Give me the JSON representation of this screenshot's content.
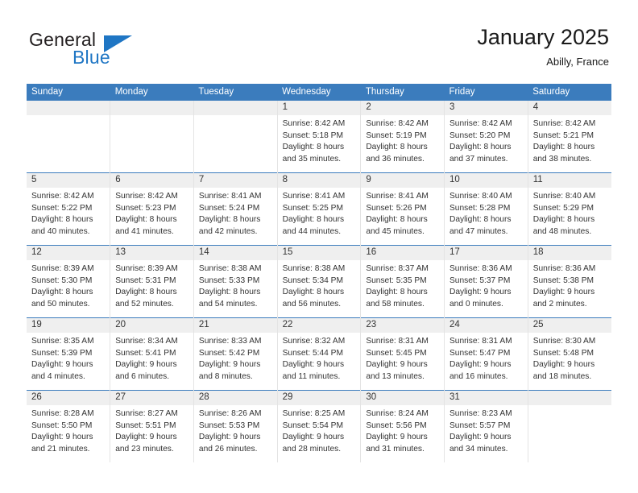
{
  "brand": {
    "name_part1": "General",
    "name_part2": "Blue",
    "triangle_color": "#1f76c4"
  },
  "header": {
    "title": "January 2025",
    "subtitle": "Abilly, France",
    "accent_color": "#3b7cbd",
    "daynum_band_color": "#efefef"
  },
  "weekday_headers": [
    "Sunday",
    "Monday",
    "Tuesday",
    "Wednesday",
    "Thursday",
    "Friday",
    "Saturday"
  ],
  "weeks": [
    [
      {
        "day": "",
        "sunrise": "",
        "sunset": "",
        "daylight_line1": "",
        "daylight_line2": ""
      },
      {
        "day": "",
        "sunrise": "",
        "sunset": "",
        "daylight_line1": "",
        "daylight_line2": ""
      },
      {
        "day": "",
        "sunrise": "",
        "sunset": "",
        "daylight_line1": "",
        "daylight_line2": ""
      },
      {
        "day": "1",
        "sunrise": "Sunrise: 8:42 AM",
        "sunset": "Sunset: 5:18 PM",
        "daylight_line1": "Daylight: 8 hours",
        "daylight_line2": "and 35 minutes."
      },
      {
        "day": "2",
        "sunrise": "Sunrise: 8:42 AM",
        "sunset": "Sunset: 5:19 PM",
        "daylight_line1": "Daylight: 8 hours",
        "daylight_line2": "and 36 minutes."
      },
      {
        "day": "3",
        "sunrise": "Sunrise: 8:42 AM",
        "sunset": "Sunset: 5:20 PM",
        "daylight_line1": "Daylight: 8 hours",
        "daylight_line2": "and 37 minutes."
      },
      {
        "day": "4",
        "sunrise": "Sunrise: 8:42 AM",
        "sunset": "Sunset: 5:21 PM",
        "daylight_line1": "Daylight: 8 hours",
        "daylight_line2": "and 38 minutes."
      }
    ],
    [
      {
        "day": "5",
        "sunrise": "Sunrise: 8:42 AM",
        "sunset": "Sunset: 5:22 PM",
        "daylight_line1": "Daylight: 8 hours",
        "daylight_line2": "and 40 minutes."
      },
      {
        "day": "6",
        "sunrise": "Sunrise: 8:42 AM",
        "sunset": "Sunset: 5:23 PM",
        "daylight_line1": "Daylight: 8 hours",
        "daylight_line2": "and 41 minutes."
      },
      {
        "day": "7",
        "sunrise": "Sunrise: 8:41 AM",
        "sunset": "Sunset: 5:24 PM",
        "daylight_line1": "Daylight: 8 hours",
        "daylight_line2": "and 42 minutes."
      },
      {
        "day": "8",
        "sunrise": "Sunrise: 8:41 AM",
        "sunset": "Sunset: 5:25 PM",
        "daylight_line1": "Daylight: 8 hours",
        "daylight_line2": "and 44 minutes."
      },
      {
        "day": "9",
        "sunrise": "Sunrise: 8:41 AM",
        "sunset": "Sunset: 5:26 PM",
        "daylight_line1": "Daylight: 8 hours",
        "daylight_line2": "and 45 minutes."
      },
      {
        "day": "10",
        "sunrise": "Sunrise: 8:40 AM",
        "sunset": "Sunset: 5:28 PM",
        "daylight_line1": "Daylight: 8 hours",
        "daylight_line2": "and 47 minutes."
      },
      {
        "day": "11",
        "sunrise": "Sunrise: 8:40 AM",
        "sunset": "Sunset: 5:29 PM",
        "daylight_line1": "Daylight: 8 hours",
        "daylight_line2": "and 48 minutes."
      }
    ],
    [
      {
        "day": "12",
        "sunrise": "Sunrise: 8:39 AM",
        "sunset": "Sunset: 5:30 PM",
        "daylight_line1": "Daylight: 8 hours",
        "daylight_line2": "and 50 minutes."
      },
      {
        "day": "13",
        "sunrise": "Sunrise: 8:39 AM",
        "sunset": "Sunset: 5:31 PM",
        "daylight_line1": "Daylight: 8 hours",
        "daylight_line2": "and 52 minutes."
      },
      {
        "day": "14",
        "sunrise": "Sunrise: 8:38 AM",
        "sunset": "Sunset: 5:33 PM",
        "daylight_line1": "Daylight: 8 hours",
        "daylight_line2": "and 54 minutes."
      },
      {
        "day": "15",
        "sunrise": "Sunrise: 8:38 AM",
        "sunset": "Sunset: 5:34 PM",
        "daylight_line1": "Daylight: 8 hours",
        "daylight_line2": "and 56 minutes."
      },
      {
        "day": "16",
        "sunrise": "Sunrise: 8:37 AM",
        "sunset": "Sunset: 5:35 PM",
        "daylight_line1": "Daylight: 8 hours",
        "daylight_line2": "and 58 minutes."
      },
      {
        "day": "17",
        "sunrise": "Sunrise: 8:36 AM",
        "sunset": "Sunset: 5:37 PM",
        "daylight_line1": "Daylight: 9 hours",
        "daylight_line2": "and 0 minutes."
      },
      {
        "day": "18",
        "sunrise": "Sunrise: 8:36 AM",
        "sunset": "Sunset: 5:38 PM",
        "daylight_line1": "Daylight: 9 hours",
        "daylight_line2": "and 2 minutes."
      }
    ],
    [
      {
        "day": "19",
        "sunrise": "Sunrise: 8:35 AM",
        "sunset": "Sunset: 5:39 PM",
        "daylight_line1": "Daylight: 9 hours",
        "daylight_line2": "and 4 minutes."
      },
      {
        "day": "20",
        "sunrise": "Sunrise: 8:34 AM",
        "sunset": "Sunset: 5:41 PM",
        "daylight_line1": "Daylight: 9 hours",
        "daylight_line2": "and 6 minutes."
      },
      {
        "day": "21",
        "sunrise": "Sunrise: 8:33 AM",
        "sunset": "Sunset: 5:42 PM",
        "daylight_line1": "Daylight: 9 hours",
        "daylight_line2": "and 8 minutes."
      },
      {
        "day": "22",
        "sunrise": "Sunrise: 8:32 AM",
        "sunset": "Sunset: 5:44 PM",
        "daylight_line1": "Daylight: 9 hours",
        "daylight_line2": "and 11 minutes."
      },
      {
        "day": "23",
        "sunrise": "Sunrise: 8:31 AM",
        "sunset": "Sunset: 5:45 PM",
        "daylight_line1": "Daylight: 9 hours",
        "daylight_line2": "and 13 minutes."
      },
      {
        "day": "24",
        "sunrise": "Sunrise: 8:31 AM",
        "sunset": "Sunset: 5:47 PM",
        "daylight_line1": "Daylight: 9 hours",
        "daylight_line2": "and 16 minutes."
      },
      {
        "day": "25",
        "sunrise": "Sunrise: 8:30 AM",
        "sunset": "Sunset: 5:48 PM",
        "daylight_line1": "Daylight: 9 hours",
        "daylight_line2": "and 18 minutes."
      }
    ],
    [
      {
        "day": "26",
        "sunrise": "Sunrise: 8:28 AM",
        "sunset": "Sunset: 5:50 PM",
        "daylight_line1": "Daylight: 9 hours",
        "daylight_line2": "and 21 minutes."
      },
      {
        "day": "27",
        "sunrise": "Sunrise: 8:27 AM",
        "sunset": "Sunset: 5:51 PM",
        "daylight_line1": "Daylight: 9 hours",
        "daylight_line2": "and 23 minutes."
      },
      {
        "day": "28",
        "sunrise": "Sunrise: 8:26 AM",
        "sunset": "Sunset: 5:53 PM",
        "daylight_line1": "Daylight: 9 hours",
        "daylight_line2": "and 26 minutes."
      },
      {
        "day": "29",
        "sunrise": "Sunrise: 8:25 AM",
        "sunset": "Sunset: 5:54 PM",
        "daylight_line1": "Daylight: 9 hours",
        "daylight_line2": "and 28 minutes."
      },
      {
        "day": "30",
        "sunrise": "Sunrise: 8:24 AM",
        "sunset": "Sunset: 5:56 PM",
        "daylight_line1": "Daylight: 9 hours",
        "daylight_line2": "and 31 minutes."
      },
      {
        "day": "31",
        "sunrise": "Sunrise: 8:23 AM",
        "sunset": "Sunset: 5:57 PM",
        "daylight_line1": "Daylight: 9 hours",
        "daylight_line2": "and 34 minutes."
      },
      {
        "day": "",
        "sunrise": "",
        "sunset": "",
        "daylight_line1": "",
        "daylight_line2": ""
      }
    ]
  ]
}
